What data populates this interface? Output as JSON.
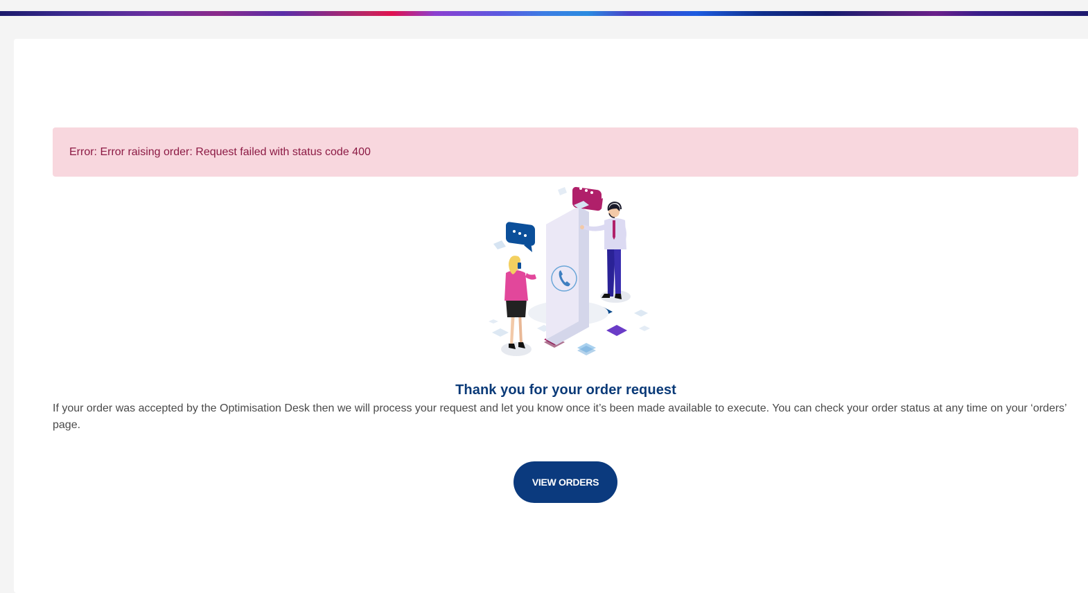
{
  "error": {
    "message": "Error: Error raising order: Request failed with status code 400"
  },
  "illustration": {
    "icon": "customer-support-phone-icon"
  },
  "confirmation": {
    "title": "Thank you for your order request",
    "body": "If your order was accepted by the Optimisation Desk then we will process your request and let you know once it’s been made available to execute. You can check your order status at any time on your ‘orders’ page."
  },
  "actions": {
    "view_orders_label": "VIEW ORDERS"
  },
  "colors": {
    "accent": "#0b3a7e",
    "error_bg": "#f8d7de",
    "error_text": "#8c1a44"
  }
}
